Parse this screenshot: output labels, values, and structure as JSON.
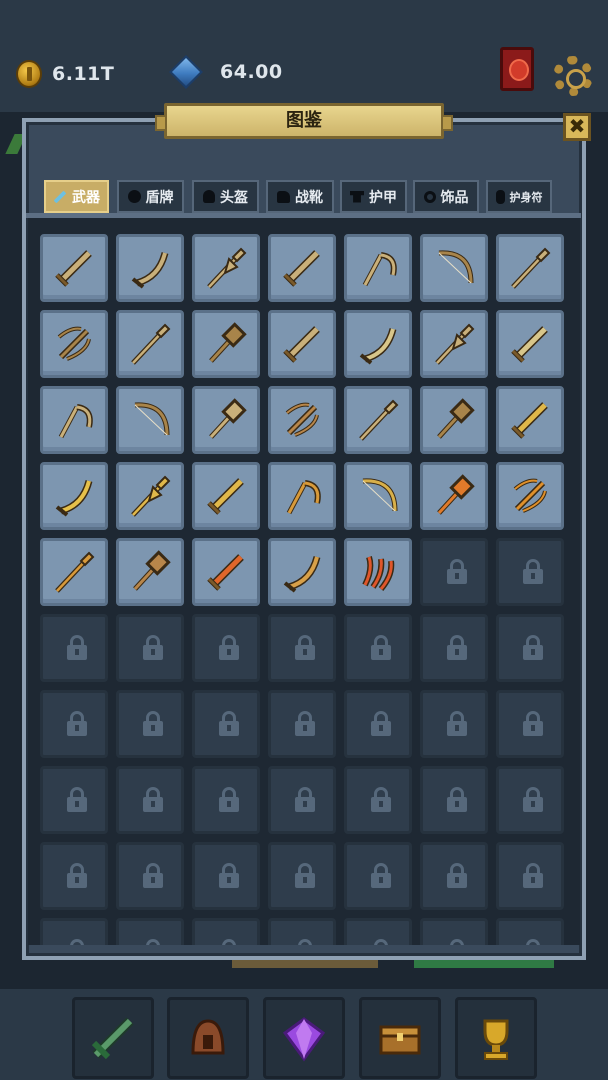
{
  "currency": {
    "coins": "6.11T",
    "gems": "64.00"
  },
  "panel": {
    "title": "图鉴",
    "close_symbol": "✖"
  },
  "tabs": [
    {
      "label": "武器",
      "icon": "sword-icon",
      "active": true
    },
    {
      "label": "盾牌",
      "icon": "shield-icon",
      "active": false
    },
    {
      "label": "头盔",
      "icon": "helmet-icon",
      "active": false
    },
    {
      "label": "战靴",
      "icon": "boot-icon",
      "active": false
    },
    {
      "label": "护甲",
      "icon": "armor-icon",
      "active": false
    },
    {
      "label": "饰品",
      "icon": "ring-icon",
      "active": false
    },
    {
      "label": "护身符",
      "icon": "amulet-icon",
      "active": false
    }
  ],
  "collection": {
    "columns": 7,
    "visible_rows": 10,
    "unlocked_items": [
      {
        "type": "dagger",
        "color": "#c9b07a"
      },
      {
        "type": "saber",
        "color": "#c9b07a"
      },
      {
        "type": "halberd",
        "color": "#c9b07a"
      },
      {
        "type": "hook-sword",
        "color": "#c9b07a"
      },
      {
        "type": "scythe",
        "color": "#c9b07a"
      },
      {
        "type": "bow",
        "color": "#a8844a"
      },
      {
        "type": "spear",
        "color": "#c9b07a"
      },
      {
        "type": "crossbow",
        "color": "#a8844a"
      },
      {
        "type": "trident",
        "color": "#c9b07a"
      },
      {
        "type": "hammer",
        "color": "#a8844a"
      },
      {
        "type": "short-sword",
        "color": "#c9b07a"
      },
      {
        "type": "scimitar",
        "color": "#d8c68a"
      },
      {
        "type": "winged-spear",
        "color": "#c9b07a"
      },
      {
        "type": "broad-sword",
        "color": "#d8c68a"
      },
      {
        "type": "sickle",
        "color": "#c9b07a"
      },
      {
        "type": "recurve-bow",
        "color": "#a8844a"
      },
      {
        "type": "mace",
        "color": "#c9b07a"
      },
      {
        "type": "heavy-crossbow",
        "color": "#b8864a"
      },
      {
        "type": "pike",
        "color": "#c9b07a"
      },
      {
        "type": "war-hammer",
        "color": "#a8844a"
      },
      {
        "type": "gold-sword",
        "color": "#e0b84a"
      },
      {
        "type": "gold-scimitar",
        "color": "#e6c04a"
      },
      {
        "type": "gold-halberd",
        "color": "#e0b84a"
      },
      {
        "type": "gold-broadsword",
        "color": "#e0b84a"
      },
      {
        "type": "gold-scythe",
        "color": "#d89a3a"
      },
      {
        "type": "gold-bow",
        "color": "#d8b04a"
      },
      {
        "type": "fire-mace",
        "color": "#e07a2a"
      },
      {
        "type": "fire-crossbow",
        "color": "#e0902a"
      },
      {
        "type": "gold-spear",
        "color": "#d89a3a"
      },
      {
        "type": "spiked-hammer",
        "color": "#b8864a"
      },
      {
        "type": "flame-sword",
        "color": "#e0662a"
      },
      {
        "type": "curved-blade",
        "color": "#d8a048"
      },
      {
        "type": "flame-claws",
        "color": "#e0562a"
      }
    ],
    "locked_icon": "lock-icon"
  },
  "bottom_nav": [
    {
      "name": "weapon",
      "icon": "sword-icon"
    },
    {
      "name": "equipment",
      "icon": "helmet-icon"
    },
    {
      "name": "gems",
      "icon": "gem-icon"
    },
    {
      "name": "chest",
      "icon": "chest-icon"
    },
    {
      "name": "trophy",
      "icon": "trophy-icon"
    }
  ]
}
